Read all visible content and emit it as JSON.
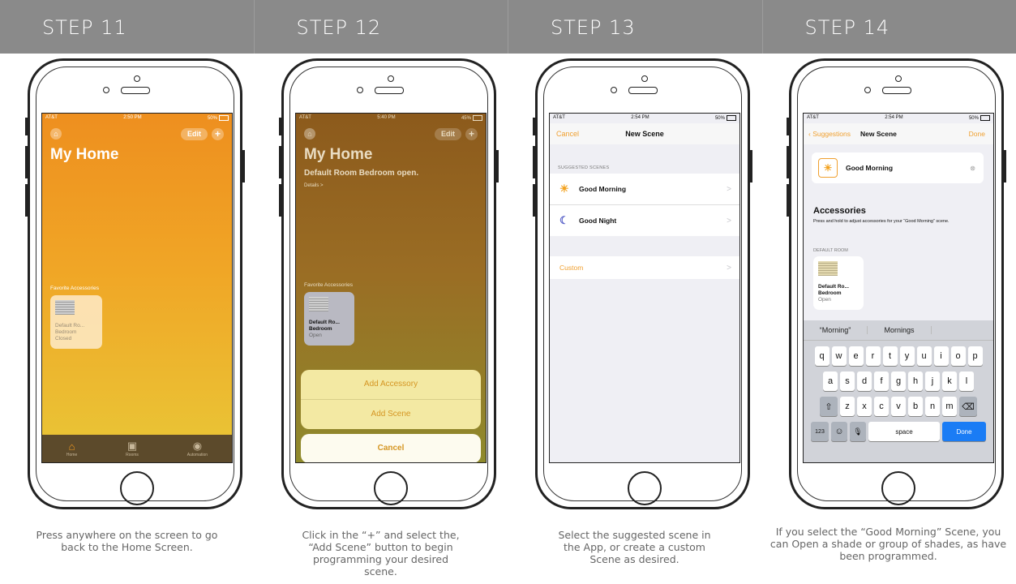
{
  "steps": [
    {
      "label": "STEP 11",
      "caption": "Press anywhere on the screen to go back to the Home Screen."
    },
    {
      "label": "STEP 12",
      "caption": "Click in the “+” and select the, “Add Scene” button to begin programming your desired scene."
    },
    {
      "label": "STEP 13",
      "caption": "Select the suggested scene in the App, or create a custom Scene as desired."
    },
    {
      "label": "STEP 14",
      "caption": "If you select the “Good Morning” Scene, you can Open a shade or group of shades, as have been programmed."
    }
  ],
  "screen1": {
    "carrier": "AT&T",
    "time": "2:50 PM",
    "battery": "50%",
    "edit": "Edit",
    "plus": "+",
    "title": "My Home",
    "favorites_label": "Favorite Accessories",
    "tile": {
      "name": "Default Ro...",
      "room": "Bedroom",
      "state": "Closed"
    },
    "tabs": [
      "Home",
      "Rooms",
      "Automation"
    ]
  },
  "screen2": {
    "carrier": "AT&T",
    "time": "5:40 PM",
    "battery": "45%",
    "edit": "Edit",
    "plus": "+",
    "title": "My Home",
    "subtitle": "Default Room Bedroom open.",
    "details": "Details >",
    "favorites_label": "Favorite Accessories",
    "tile": {
      "name": "Default Ro...",
      "room": "Bedroom",
      "state": "Open"
    },
    "sheet": {
      "add_accessory": "Add Accessory",
      "add_scene": "Add Scene",
      "cancel": "Cancel"
    }
  },
  "screen3": {
    "carrier": "AT&T",
    "time": "2:54 PM",
    "battery": "50%",
    "cancel": "Cancel",
    "title": "New Scene",
    "section": "SUGGESTED SCENES",
    "scenes": [
      "Good Morning",
      "Good Night"
    ],
    "custom": "Custom",
    "chevron": ">"
  },
  "screen4": {
    "carrier": "AT&T",
    "time": "2:54 PM",
    "battery": "50%",
    "back": "Suggestions",
    "title": "New Scene",
    "done": "Done",
    "scene_name": "Good Morning",
    "accessories_title": "Accessories",
    "accessories_hint": "Press and hold to adjust accessories for your “Good Morning” scene.",
    "room_label": "DEFAULT ROOM",
    "tile": {
      "name": "Default Ro...",
      "room": "Bedroom",
      "state": "Open"
    },
    "suggestions": [
      "“Morning”",
      "Mornings"
    ],
    "rows": [
      [
        "q",
        "w",
        "e",
        "r",
        "t",
        "y",
        "u",
        "i",
        "o",
        "p"
      ],
      [
        "a",
        "s",
        "d",
        "f",
        "g",
        "h",
        "j",
        "k",
        "l"
      ],
      [
        "z",
        "x",
        "c",
        "v",
        "b",
        "n",
        "m"
      ]
    ],
    "key_123": "123",
    "key_space": "space",
    "key_done": "Done"
  },
  "colors": {
    "header": "#8a8a8a",
    "accent_orange": "#ee8f1f",
    "ios_blue": "#1a7cf5"
  }
}
